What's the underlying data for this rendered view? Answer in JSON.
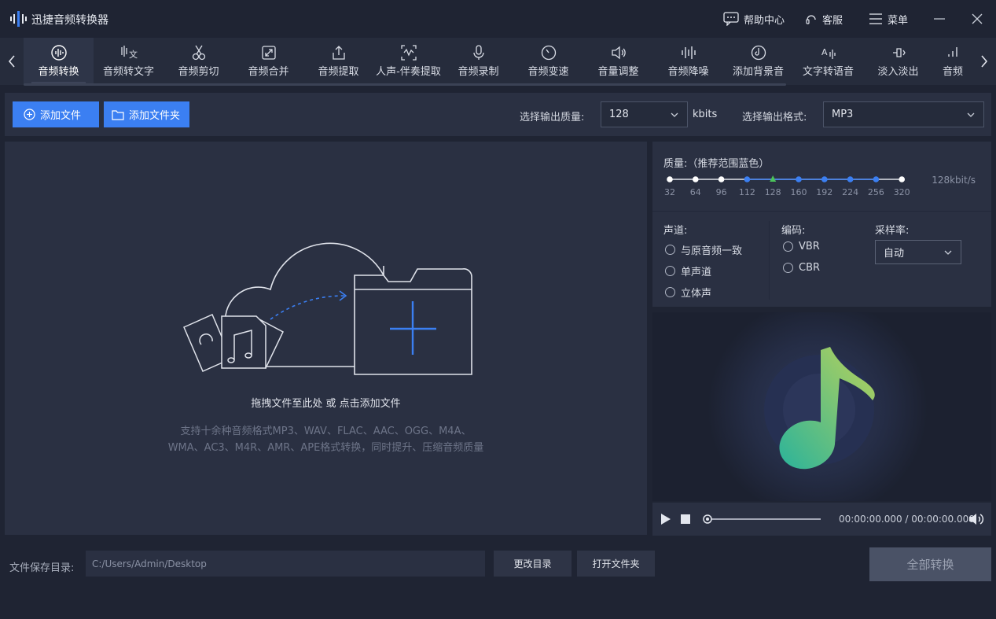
{
  "app": {
    "title": "迅捷音频转换器"
  },
  "titlebar": {
    "help_label": "帮助中心",
    "service_label": "客服",
    "menu_label": "菜单"
  },
  "tools": [
    {
      "label": "音频转换",
      "icon": "audio-wave-circle-icon",
      "active": true
    },
    {
      "label": "音频转文字",
      "icon": "speech-to-text-icon"
    },
    {
      "label": "音频剪切",
      "icon": "scissors-icon"
    },
    {
      "label": "音频合并",
      "icon": "merge-icon"
    },
    {
      "label": "音频提取",
      "icon": "upload-box-icon"
    },
    {
      "label": "人声-伴奏提取",
      "icon": "vocal-wave-icon"
    },
    {
      "label": "音频录制",
      "icon": "microphone-icon"
    },
    {
      "label": "音频变速",
      "icon": "speed-dial-icon"
    },
    {
      "label": "音量调整",
      "icon": "speaker-volume-icon"
    },
    {
      "label": "音频降噪",
      "icon": "noise-bars-icon"
    },
    {
      "label": "添加背景音",
      "icon": "music-disc-icon"
    },
    {
      "label": "文字转语音",
      "icon": "text-to-speech-icon"
    },
    {
      "label": "淡入淡出",
      "icon": "fade-icon"
    },
    {
      "label": "音频",
      "icon": "bars-icon"
    }
  ],
  "actions": {
    "add_file": "添加文件",
    "add_folder": "添加文件夹",
    "quality_label": "选择输出质量:",
    "quality_value": "128",
    "quality_unit": "kbits",
    "format_label": "选择输出格式:",
    "format_value": "MP3"
  },
  "dropzone": {
    "main_text": "拖拽文件至此处 或 点击添加文件",
    "sub_line1": "支持十余种音频格式MP3、WAV、FLAC、AAC、OGG、M4A、",
    "sub_line2": "WMA、AC3、M4R、AMR、APE格式转换，同时提升、压缩音频质量"
  },
  "quality": {
    "title": "质量:（推荐范围蓝色）",
    "value": "128kbit/s",
    "ticks": [
      "32",
      "64",
      "96",
      "112",
      "128",
      "160",
      "192",
      "224",
      "256",
      "320"
    ],
    "selected_index": 4,
    "recommended_range": [
      3,
      8
    ]
  },
  "options": {
    "channel_label": "声道:",
    "channels": [
      "与原音频一致",
      "单声道",
      "立体声"
    ],
    "encoding_label": "编码:",
    "encodings": [
      "VBR",
      "CBR"
    ],
    "samplerate_label": "采样率:",
    "samplerate_value": "自动"
  },
  "player": {
    "time": "00:00:00.000 / 00:00:00.000"
  },
  "bottom": {
    "save_label": "文件保存目录:",
    "path": "C:/Users/Admin/Desktop",
    "change_dir": "更改目录",
    "open_folder": "打开文件夹",
    "convert_all": "全部转换"
  },
  "colors": {
    "accent": "#3b7ff2",
    "selected_tick": "#4cc35a",
    "background": "#1f2433",
    "panel": "#2a3042"
  }
}
